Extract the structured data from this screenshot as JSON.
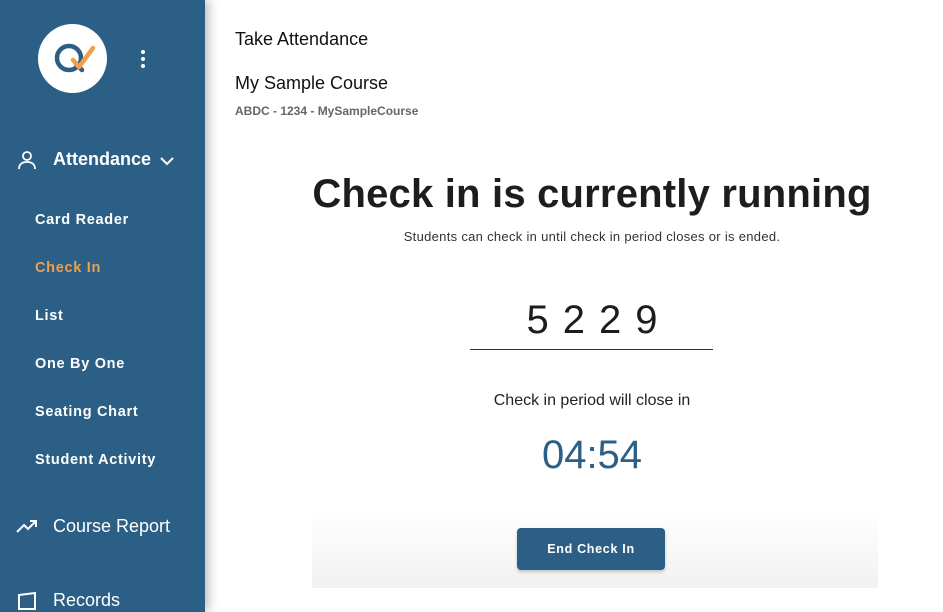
{
  "sidebar": {
    "attendance_label": "Attendance",
    "items": [
      {
        "label": "Card Reader",
        "active": false
      },
      {
        "label": "Check In",
        "active": true
      },
      {
        "label": "List",
        "active": false
      },
      {
        "label": "One By One",
        "active": false
      },
      {
        "label": "Seating Chart",
        "active": false
      },
      {
        "label": "Student Activity",
        "active": false
      }
    ],
    "course_report_label": "Course Report",
    "records_label": "Records"
  },
  "header": {
    "title": "Take Attendance",
    "course_name": "My Sample Course",
    "course_code": "ABDC - 1234 - MySampleCourse"
  },
  "checkin": {
    "heading": "Check in is currently running",
    "subtext": "Students can check in until check in period closes or is ended.",
    "code": "5229",
    "closes_label": "Check in period will close in",
    "timer": "04:54",
    "end_button_label": "End Check In"
  },
  "colors": {
    "sidebar_bg": "#2c5f86",
    "active_item": "#f0a04b",
    "accent": "#2c5f86"
  }
}
